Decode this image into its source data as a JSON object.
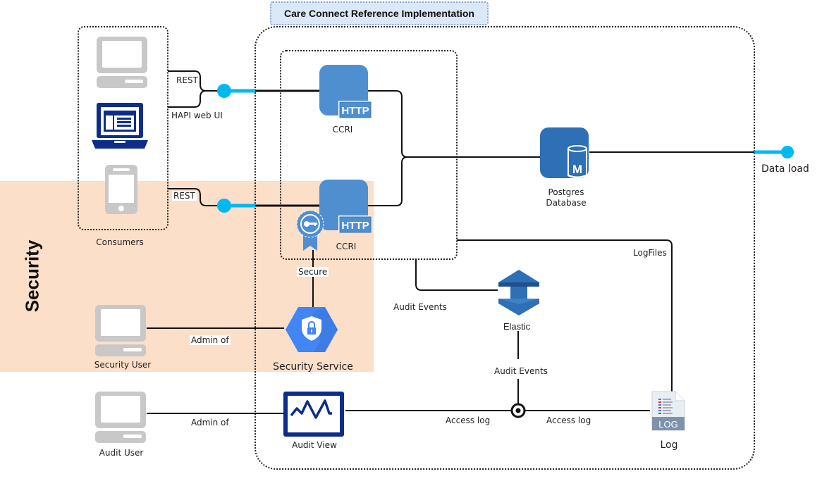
{
  "title": "Care Connect Reference Implementation",
  "zone": {
    "label": "Security",
    "color": "#fbdfc8"
  },
  "colors": {
    "connector_accent": "#00b9f1",
    "ccri_blue": "#4f8fd0",
    "db_blue": "#2f6fb5",
    "laptop_navy": "#0c2d8c",
    "security_blue": "#4285f4",
    "device_grey": "#c8c8c8"
  },
  "consumers": {
    "group_label": "Consumers",
    "devices": [
      {
        "icon": "desktop-computer-icon"
      },
      {
        "icon": "laptop-web-ui-icon"
      },
      {
        "icon": "mobile-phone-icon"
      }
    ]
  },
  "connections": {
    "rest_1": "REST",
    "hapi": "HAPI web UI",
    "rest_2": "REST",
    "secure": "Secure",
    "admin_security": "Admin of",
    "admin_audit": "Admin of",
    "audit_events_1": "Audit Events",
    "audit_events_2": "Audit Events",
    "access_log_1": "Access log",
    "access_log_2": "Access log",
    "logfiles": "LogFiles",
    "data_load": "Data load"
  },
  "nodes": {
    "ccri_top": {
      "label": "CCRI",
      "badge": "HTTP"
    },
    "ccri_secure": {
      "label": "CCRI",
      "badge": "HTTP"
    },
    "postgres": {
      "label_line1": "Postgres",
      "label_line2": "Database",
      "badge": "M"
    },
    "elastic": {
      "label": "Elastic"
    },
    "security_service": {
      "label": "Security Service"
    },
    "security_user": {
      "label": "Security User"
    },
    "audit_user": {
      "label": "Audit User"
    },
    "audit_view": {
      "label": "Audit View"
    },
    "log": {
      "label": "Log",
      "badge": "LOG"
    }
  }
}
